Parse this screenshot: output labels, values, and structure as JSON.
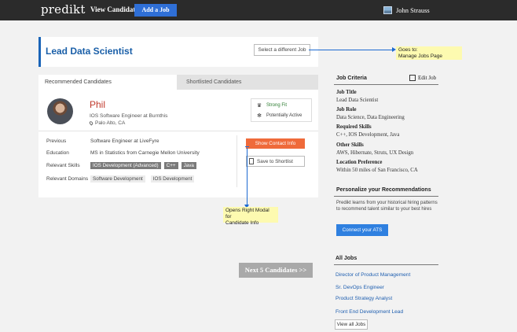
{
  "navbar": {
    "brand": "predikt",
    "view_candidates": "View Candidates",
    "add_job": "Add a Job",
    "user_name": "John Strauss"
  },
  "job_header": {
    "title": "Lead Data Scientist",
    "select_button": "Select a different Job"
  },
  "annotations": {
    "manage_jobs": "Goes to:\nManage Jobs Page",
    "right_modal": "Opens Right Modal for\nCandidate Info"
  },
  "tabs": [
    {
      "label": "Recommended Candidates",
      "active": true
    },
    {
      "label": "Shortlisted Candidates",
      "active": false
    }
  ],
  "candidate": {
    "name": "Phil",
    "role": "IOS Software Engineer at Burnthis",
    "location": "Palo Alto, CA",
    "fit": "Strong Fit",
    "activity": "Potentially Active",
    "details": {
      "previous_label": "Previous",
      "previous_value": "Software Engineer at LiveFyre",
      "education_label": "Education",
      "education_value": "MS in Statistics from Carnegie Mellon University",
      "skills_label": "Relevant Skills",
      "skills": [
        "IOS Development (Advanced)",
        "C++",
        "Java"
      ],
      "domains_label": "Relevant Domains",
      "domains": [
        "Software Development",
        "IOS Development"
      ]
    },
    "contact_button": "Show Contact Info",
    "shortlist_button": "Save to Shortlist"
  },
  "next_button": "Next 5 Candidates >>",
  "criteria": {
    "title": "Job Criteria",
    "edit": "Edit Job",
    "items": [
      {
        "label": "Job Title",
        "value": "Lead Data Scientist"
      },
      {
        "label": "Job Role",
        "value": "Data Science, Data Engineering"
      },
      {
        "label": "Required Skills",
        "value": "C++, IOS Development, Java"
      },
      {
        "label": "Other Skills",
        "value": "AWS, Hibernate, Struts, UX Design"
      },
      {
        "label": "Location Preference",
        "value": "Within 50 miles of San Francisco, CA"
      }
    ]
  },
  "personalize": {
    "title": "Personalize your Recommendations",
    "text": "Predikt learns from your historical hiring patterns to recommend talent similar to your best hires",
    "button": "Connect your ATS"
  },
  "all_jobs": {
    "title": "All Jobs",
    "jobs": [
      "Director of Product Management",
      "Sr. DevOps Engineer",
      "Product Strategy Analyst",
      "Front End Development Lead"
    ],
    "view_all": "View all Jobs"
  },
  "colors": {
    "navbar": "#2b2b2b",
    "primary_blue": "#2f6fd6",
    "candidate_name": "#c0392b",
    "contact_orange": "#ef6a3a",
    "annotation_yellow": "#fdfab0"
  },
  "icons": [
    "user-avatar-icon",
    "pin-icon",
    "strong-fit-icon",
    "active-icon",
    "bookmark-icon",
    "edit-icon"
  ]
}
